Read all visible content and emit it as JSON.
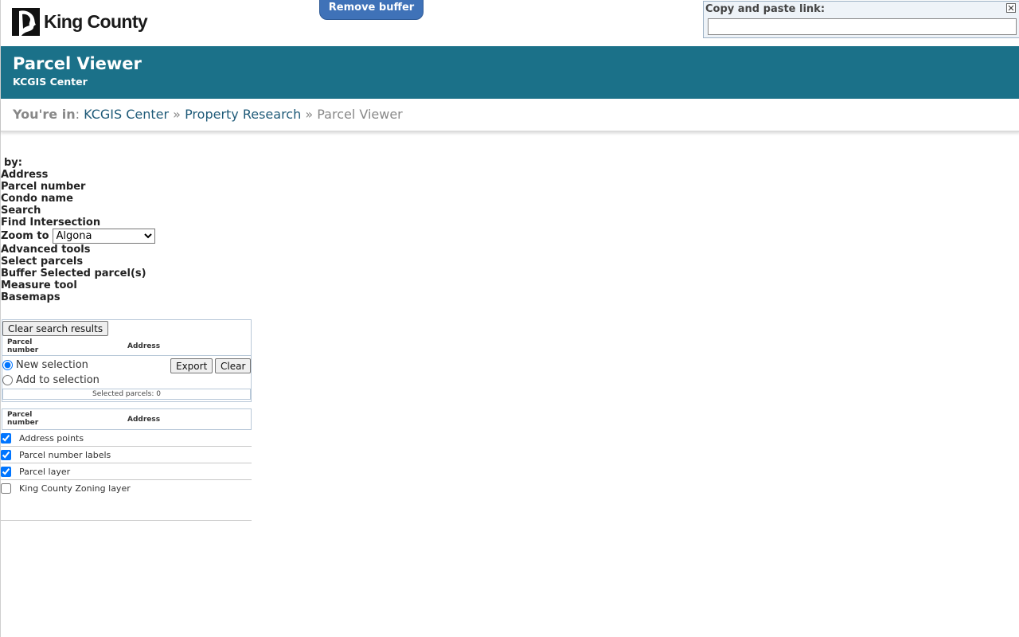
{
  "header": {
    "logo_text": "King County",
    "remove_buffer_label": "Remove buffer",
    "link_box": {
      "label": "Copy and paste link:",
      "value": ""
    }
  },
  "banner": {
    "title": "Parcel Viewer",
    "subtitle": "KCGIS Center"
  },
  "breadcrumb": {
    "prefix": "You're in",
    "colon": ":",
    "items": [
      "KCGIS Center",
      "Property Research",
      "Parcel Viewer"
    ],
    "separator": "»"
  },
  "tools": {
    "by_label": "by:",
    "items": [
      "Address",
      "Parcel number",
      "Condo name",
      "Search",
      "Find Intersection"
    ],
    "zoom_label": "Zoom to",
    "zoom_selected": "Algona",
    "advanced_items": [
      "Advanced tools",
      "Select parcels",
      "Buffer Selected parcel(s)",
      "Measure tool",
      "Basemaps"
    ]
  },
  "results": {
    "clear_search_label": "Clear search results",
    "col_parcel_line1": "Parcel",
    "col_parcel_line2": "number",
    "col_address": "Address",
    "new_selection_label": "New selection",
    "add_selection_label": "Add to selection",
    "export_label": "Export",
    "clear_label": "Clear",
    "selected_count": "Selected parcels: 0"
  },
  "selected_table": {
    "col_parcel_line1": "Parcel",
    "col_parcel_line2": "number",
    "col_address": "Address"
  },
  "layers": [
    {
      "label": "Address points",
      "checked": true
    },
    {
      "label": "Parcel number labels",
      "checked": true
    },
    {
      "label": "Parcel layer",
      "checked": true
    },
    {
      "label": "King County Zoning layer",
      "checked": false
    }
  ]
}
